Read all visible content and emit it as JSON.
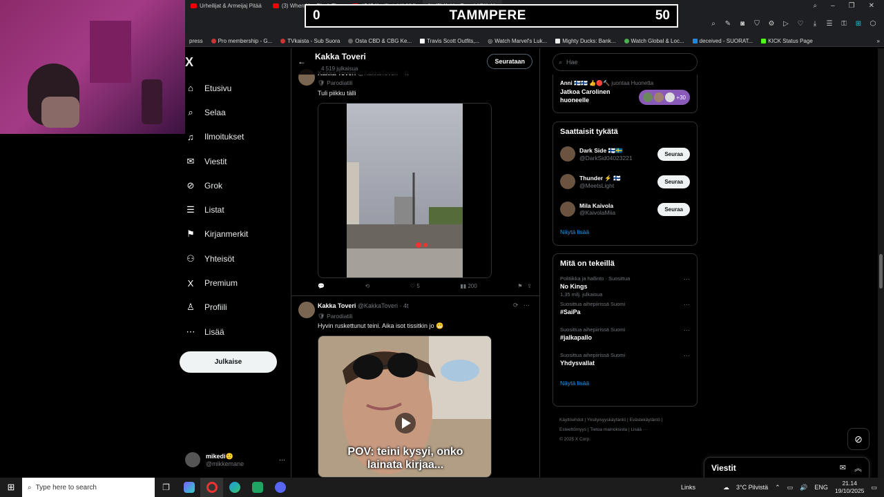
{
  "browser": {
    "tabs": [
      {
        "label": "Urheilijat & Armeijaj Pitää"
      },
      {
        "label": "(3) When You Block The"
      },
      {
        "label": "#242 Koville tyhjä NHL"
      },
      {
        "label": "(3) Kakka Toveri (@Kakk"
      }
    ],
    "new_tab": "+",
    "bookmarks": [
      {
        "label": "press"
      },
      {
        "label": "Pro membership - G..."
      },
      {
        "label": "TVkaista - Sub Suora"
      },
      {
        "label": "Osta CBD & CBG Ke..."
      },
      {
        "label": "Travis Scott Outfits,..."
      },
      {
        "label": "Watch Marvel's Luk..."
      },
      {
        "label": "Mighty Ducks: Bank..."
      },
      {
        "label": "Watch Global & Loc..."
      },
      {
        "label": "deceived - SUORAT..."
      },
      {
        "label": "KICK Status Page"
      }
    ]
  },
  "scoreboard": {
    "left_score": "0",
    "team": "TAMMPERE",
    "right_score": "50"
  },
  "sidebar": {
    "logo": "X",
    "items": [
      {
        "label": "Etusivu",
        "icon": "home-icon",
        "glyph": "⌂"
      },
      {
        "label": "Selaa",
        "icon": "search-icon",
        "glyph": "⌕"
      },
      {
        "label": "Ilmoitukset",
        "icon": "bell-icon",
        "glyph": "♫"
      },
      {
        "label": "Viestit",
        "icon": "mail-icon",
        "glyph": "✉"
      },
      {
        "label": "Grok",
        "icon": "grok-icon",
        "glyph": "⊘"
      },
      {
        "label": "Listat",
        "icon": "list-icon",
        "glyph": "☰"
      },
      {
        "label": "Kirjanmerkit",
        "icon": "bookmark-icon",
        "glyph": "⚑"
      },
      {
        "label": "Yhteisöt",
        "icon": "communities-icon",
        "glyph": "⚇"
      },
      {
        "label": "Premium",
        "icon": "x-premium-icon",
        "glyph": "X"
      },
      {
        "label": "Profiili",
        "icon": "profile-icon",
        "glyph": "♙"
      },
      {
        "label": "Lisää",
        "icon": "more-icon",
        "glyph": "⋯"
      }
    ],
    "post_button": "Julkaise",
    "user": {
      "name": "mikedi🙂",
      "handle": "@mikkemane",
      "more": "···"
    }
  },
  "profile_header": {
    "name": "Kakka Toveri",
    "post_count": "4 519 julkaisua",
    "follow_button": "Seurataan"
  },
  "tweets": [
    {
      "name": "Kakka Toveri",
      "handle": "@KakkaToveri · 4t",
      "badge": "Parodiatili",
      "text": "Tuli piikku tälli",
      "actions": {
        "reply": "",
        "retweet": "",
        "likes": "5",
        "views": "200"
      }
    },
    {
      "name": "Kakka Toveri",
      "handle": "@KakkaToveri · 4t",
      "badge": "Parodiatili",
      "text": "Hyvin ruskettunut teini. Aika isot tissitkin jo 😬",
      "video_caption_1": "POV: teini kysyi, onko",
      "video_caption_2": "lainata kirjaa..."
    }
  ],
  "right": {
    "search_placeholder": "Hae",
    "space": {
      "line1": "Anni 🇫🇮🇫🇮 👍🔴🔨",
      "line1_suffix": "juontaa Huonetta",
      "title": "Jatkoa Carolinen huoneelle",
      "count": "+30"
    },
    "who_to_follow": {
      "title": "Saattaisit tykätä",
      "people": [
        {
          "name": "Dark Side 🇫🇮🇸🇪",
          "handle": "@DarkSid04023221",
          "button": "Seuraa"
        },
        {
          "name": "Thunder ⚡ 🇫🇮",
          "handle": "@MeetsLight",
          "button": "Seuraa"
        },
        {
          "name": "Mila Kaivola",
          "handle": "@KaivolaMiia",
          "button": "Seuraa"
        }
      ],
      "show_more": "Näytä lisää"
    },
    "trends": {
      "title": "Mitä on tekeillä",
      "items": [
        {
          "context": "Politiikka ja hallinto · Suosittua",
          "name": "No Kings",
          "posts": "1,35 milj. julkaisua"
        },
        {
          "context": "Suosittua aihepiirissä Suomi",
          "name": "#SaiPa",
          "posts": ""
        },
        {
          "context": "Suosittua aihepiirissä Suomi",
          "name": "#jalkapallo",
          "posts": ""
        },
        {
          "context": "Suosittua aihepiirissä Suomi",
          "name": "Yhdysvallat",
          "posts": ""
        }
      ],
      "show_more": "Näytä lisää"
    },
    "footer": {
      "line1": "Käyttöehdot  |  Yksityisyyskäytäntö  |  Evästekäytäntö  |",
      "line2": "Esteettömyys  |  Tietoa mainoksista  |  Lisää ···",
      "line3": "© 2025 X Corp."
    }
  },
  "messages_drawer": {
    "title": "Viestit"
  },
  "taskbar": {
    "search_placeholder": "Type here to search",
    "links": "Links",
    "weather": "3°C  Pilvistä",
    "lang": "ENG",
    "time": "21.14",
    "date": "19/10/2025"
  },
  "colors": {
    "accent": "#1d9bf0",
    "background": "#000000",
    "text": "#e7e9ea",
    "muted": "#71767b"
  }
}
